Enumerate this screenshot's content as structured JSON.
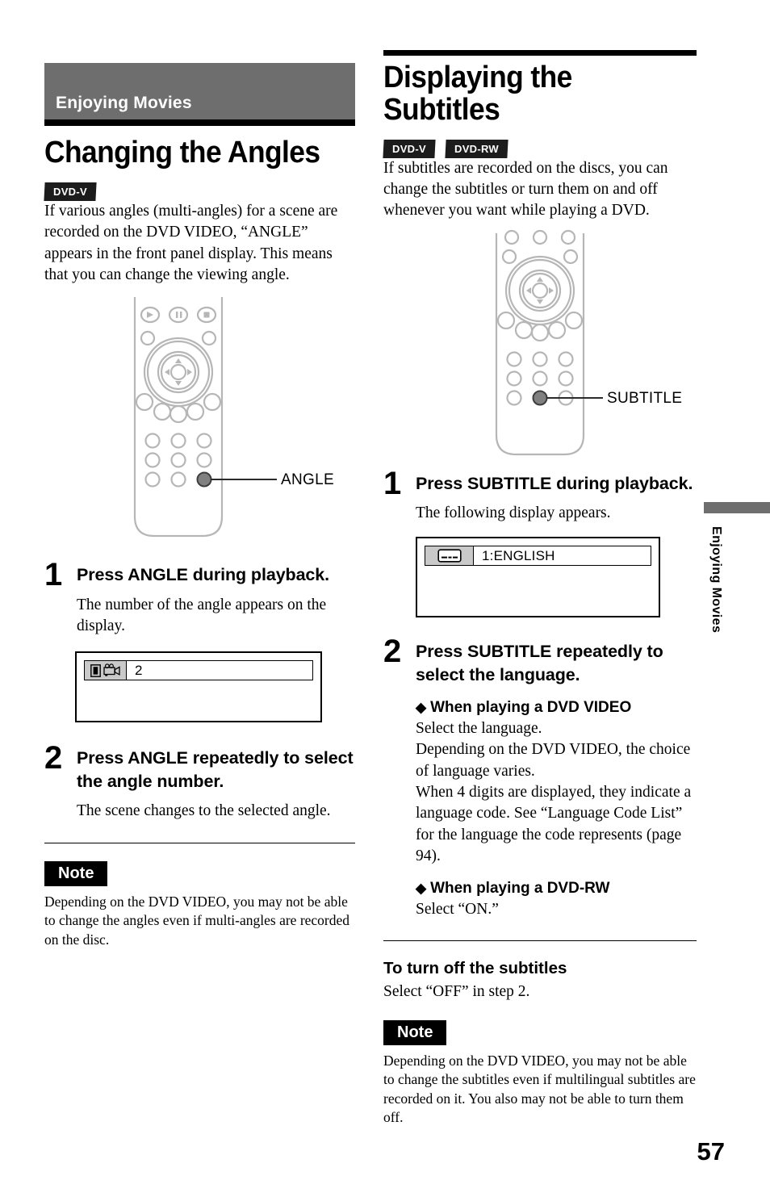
{
  "document": {
    "page_number": "57",
    "side_tab_label": "Enjoying Movies"
  },
  "left_column": {
    "chapter_banner": "Enjoying Movies",
    "title": "Changing the Angles",
    "badges": [
      "DVD-V"
    ],
    "intro": "If various angles (multi-angles) for a scene are recorded on the DVD VIDEO, “ANGLE” appears in the front panel display. This means that you can change the viewing angle.",
    "remote_callout": "ANGLE",
    "steps": [
      {
        "number": "1",
        "title": "Press ANGLE during playback.",
        "desc": "The number of the angle appears on the display."
      },
      {
        "number": "2",
        "title": "Press ANGLE repeatedly to select the angle number.",
        "desc": "The scene changes to the selected angle."
      }
    ],
    "osd": {
      "value": "2",
      "icon_left": "multi-angle-indicator-icon",
      "icon_camera": "video-camera-icon"
    },
    "note": {
      "label": "Note",
      "text": "Depending on the DVD VIDEO, you may not be able to change the angles even if multi-angles are recorded on the disc."
    }
  },
  "right_column": {
    "title": "Displaying the Subtitles",
    "badges": [
      "DVD-V",
      "DVD-RW"
    ],
    "intro": "If subtitles are recorded on the discs, you can change the subtitles or turn them on and off whenever you want while playing a DVD.",
    "remote_callout": "SUBTITLE",
    "steps": [
      {
        "number": "1",
        "title": "Press SUBTITLE during playback.",
        "desc": "The following display appears."
      },
      {
        "number": "2",
        "title": "Press SUBTITLE repeatedly to select the language.",
        "desc": ""
      }
    ],
    "osd": {
      "value": "1:ENGLISH",
      "icon": "subtitle-icon"
    },
    "subsections": [
      {
        "heading": "When playing a DVD VIDEO",
        "body": "Select the language.\nDepending on the DVD VIDEO, the choice of language varies.\nWhen 4 digits are displayed, they indicate a language code. See “Language Code List” for the language the code represents (page 94)."
      },
      {
        "heading": "When playing a DVD-RW",
        "body": "Select “ON.”"
      }
    ],
    "minor_head": "To turn off the subtitles",
    "minor_body": "Select “OFF” in step 2.",
    "note": {
      "label": "Note",
      "text": "Depending on the DVD VIDEO, you may not be able to change the subtitles even if multilingual subtitles are recorded on it. You also may not be able to turn them off."
    }
  },
  "colors": {
    "banner_gray": "#6e6e6e",
    "badge_black": "#1c1c1c",
    "remote_outline": "#b6b6b6",
    "highlight_button": "#808080"
  }
}
